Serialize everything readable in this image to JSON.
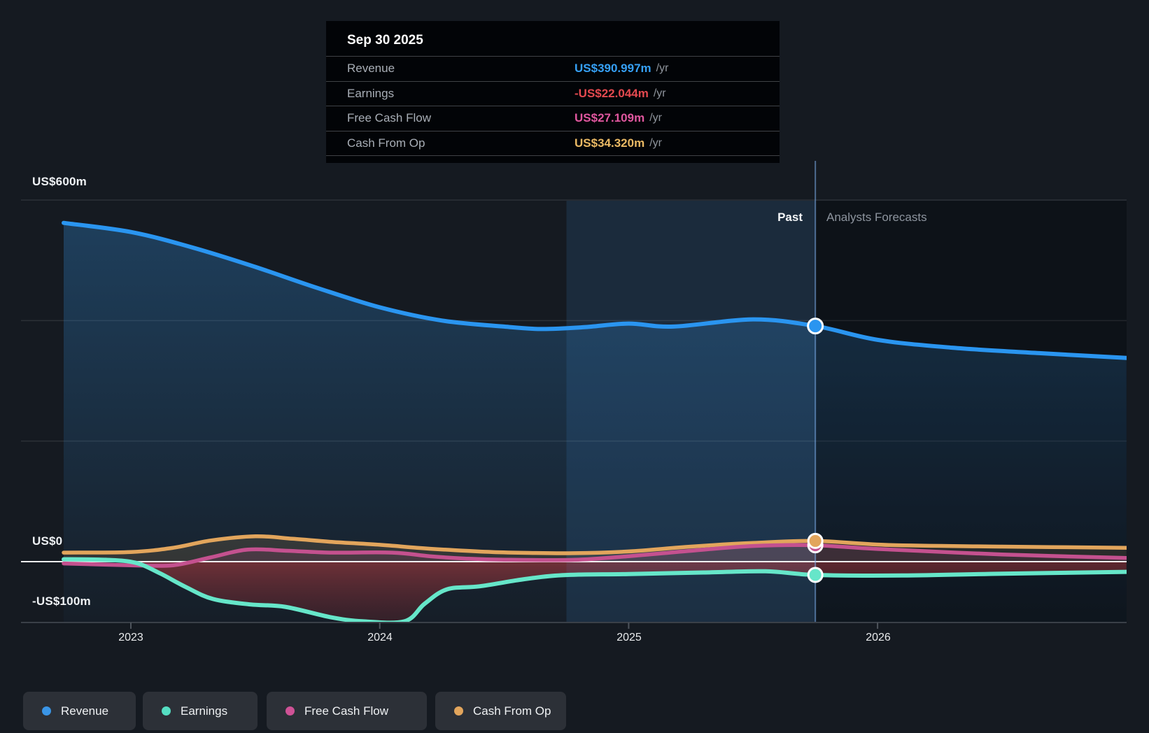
{
  "tooltip": {
    "date": "Sep 30 2025",
    "rows": [
      {
        "label": "Revenue",
        "value": "US$390.997m",
        "suffix": "/yr",
        "color": "#36a0f5"
      },
      {
        "label": "Earnings",
        "value": "-US$22.044m",
        "suffix": "/yr",
        "color": "#e4494f"
      },
      {
        "label": "Free Cash Flow",
        "value": "US$27.109m",
        "suffix": "/yr",
        "color": "#e0579f"
      },
      {
        "label": "Cash From Op",
        "value": "US$34.320m",
        "suffix": "/yr",
        "color": "#eab964"
      }
    ]
  },
  "annotations": {
    "past": "Past",
    "forecast": "Analysts Forecasts"
  },
  "axis": {
    "y_labels": [
      {
        "text": "US$600m",
        "value": 600
      },
      {
        "text": "US$0",
        "value": 0
      },
      {
        "text": "-US$100m",
        "value": -100
      }
    ],
    "x_labels": [
      {
        "text": "2023",
        "year": 2023
      },
      {
        "text": "2024",
        "year": 2024
      },
      {
        "text": "2025",
        "year": 2025
      },
      {
        "text": "2026",
        "year": 2026
      }
    ]
  },
  "legend": [
    {
      "label": "Revenue",
      "color": "#3a95e6"
    },
    {
      "label": "Earnings",
      "color": "#55dec2"
    },
    {
      "label": "Free Cash Flow",
      "color": "#cf5296"
    },
    {
      "label": "Cash From Op",
      "color": "#e2a55c"
    }
  ],
  "colors": {
    "background": "#151a21",
    "zero_line": "#ffffff",
    "grid_line": "rgba(255,255,255,0.10)",
    "axis_line": "#3a4048",
    "divider_line": "rgba(128,178,240,0.55)",
    "past_band": "rgba(62,134,205,0.115)",
    "forecast_shade": "rgba(4,7,11,0.38)"
  },
  "chart_data": {
    "type": "area",
    "x_unit": "year",
    "xlim": [
      2022.73,
      2027.0
    ],
    "ylim": [
      -100,
      600
    ],
    "gridline_values": [
      600,
      400,
      200
    ],
    "zero_line": 0,
    "past_band": [
      2024.75,
      2025.75
    ],
    "forecast_start": 2025.75,
    "marker_x": 2025.75,
    "series": [
      {
        "name": "Revenue",
        "color": "#2a95f0",
        "marker_value": 390.997,
        "points": [
          [
            2022.73,
            562
          ],
          [
            2023.0,
            547
          ],
          [
            2023.25,
            521
          ],
          [
            2023.5,
            489
          ],
          [
            2023.75,
            454
          ],
          [
            2024.0,
            422
          ],
          [
            2024.25,
            400
          ],
          [
            2024.5,
            390
          ],
          [
            2024.65,
            386
          ],
          [
            2024.82,
            389
          ],
          [
            2025.0,
            395
          ],
          [
            2025.18,
            390
          ],
          [
            2025.5,
            402
          ],
          [
            2025.75,
            391
          ],
          [
            2026.0,
            368
          ],
          [
            2026.3,
            355
          ],
          [
            2026.65,
            346
          ],
          [
            2027.0,
            338
          ]
        ]
      },
      {
        "name": "Earnings",
        "color": "#66e6c9",
        "marker_value": -22.044,
        "points": [
          [
            2022.73,
            4
          ],
          [
            2022.9,
            3
          ],
          [
            2023.02,
            -2
          ],
          [
            2023.12,
            -20
          ],
          [
            2023.22,
            -42
          ],
          [
            2023.33,
            -62
          ],
          [
            2023.48,
            -71
          ],
          [
            2023.62,
            -75
          ],
          [
            2023.8,
            -92
          ],
          [
            2023.93,
            -99
          ],
          [
            2024.1,
            -99
          ],
          [
            2024.18,
            -70
          ],
          [
            2024.27,
            -46
          ],
          [
            2024.4,
            -41
          ],
          [
            2024.55,
            -31
          ],
          [
            2024.68,
            -24
          ],
          [
            2024.8,
            -21.5
          ],
          [
            2025.0,
            -20.5
          ],
          [
            2025.3,
            -18
          ],
          [
            2025.55,
            -16
          ],
          [
            2025.75,
            -22
          ],
          [
            2026.1,
            -23
          ],
          [
            2026.5,
            -20
          ],
          [
            2027.0,
            -17
          ]
        ]
      },
      {
        "name": "Free Cash Flow",
        "color": "#c4518f",
        "marker_value": 27.109,
        "points": [
          [
            2022.73,
            -3
          ],
          [
            2023.0,
            -6
          ],
          [
            2023.17,
            -6
          ],
          [
            2023.32,
            7
          ],
          [
            2023.47,
            20
          ],
          [
            2023.63,
            18
          ],
          [
            2023.8,
            15
          ],
          [
            2024.05,
            15
          ],
          [
            2024.2,
            9
          ],
          [
            2024.35,
            5
          ],
          [
            2024.5,
            3.2
          ],
          [
            2024.78,
            3
          ],
          [
            2025.0,
            9
          ],
          [
            2025.25,
            18
          ],
          [
            2025.5,
            26
          ],
          [
            2025.75,
            27.1
          ],
          [
            2026.0,
            21
          ],
          [
            2026.5,
            12
          ],
          [
            2027.0,
            6
          ]
        ]
      },
      {
        "name": "Cash From Op",
        "color": "#e2a55c",
        "marker_value": 34.32,
        "points": [
          [
            2022.73,
            15
          ],
          [
            2023.0,
            16
          ],
          [
            2023.17,
            23
          ],
          [
            2023.32,
            35
          ],
          [
            2023.5,
            42
          ],
          [
            2023.65,
            38
          ],
          [
            2023.8,
            33
          ],
          [
            2024.0,
            28
          ],
          [
            2024.15,
            23
          ],
          [
            2024.3,
            19
          ],
          [
            2024.45,
            16
          ],
          [
            2024.6,
            14.5
          ],
          [
            2024.78,
            14
          ],
          [
            2025.0,
            17
          ],
          [
            2025.25,
            25
          ],
          [
            2025.5,
            31
          ],
          [
            2025.75,
            34.3
          ],
          [
            2026.05,
            27.5
          ],
          [
            2026.5,
            25
          ],
          [
            2027.0,
            23
          ]
        ]
      }
    ]
  }
}
